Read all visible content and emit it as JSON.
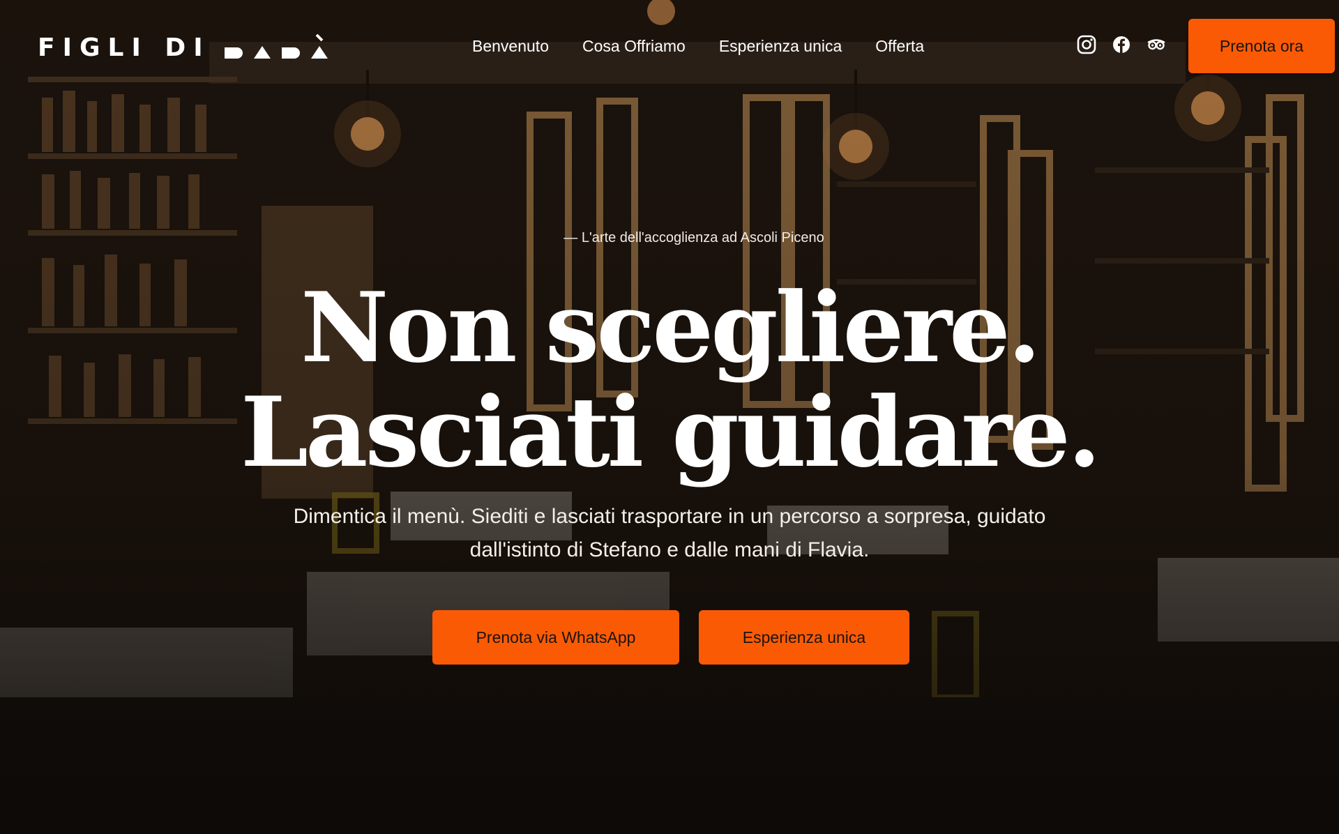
{
  "brand": {
    "logo_text": "FIGLI DI PAPÀ",
    "logo_visible_text": "FIGLI DI"
  },
  "nav": {
    "items": [
      {
        "label": "Benvenuto"
      },
      {
        "label": "Cosa Offriamo"
      },
      {
        "label": "Esperienza unica"
      },
      {
        "label": "Offerta"
      }
    ]
  },
  "socials": [
    {
      "icon": "instagram-icon"
    },
    {
      "icon": "facebook-icon"
    },
    {
      "icon": "tripadvisor-icon"
    }
  ],
  "header": {
    "cta_label": "Prenota ora"
  },
  "hero": {
    "kicker": "— L'arte dell'accoglienza ad Ascoli Piceno",
    "headline_line1": "Non scegliere.",
    "headline_line2": "Lasciati guidare.",
    "subtitle": "Dimentica il menù. Siediti e lasciati trasportare in un percorso a sorpresa, guidato dall'istinto di Stefano e dalle mani di Flavia.",
    "button_primary": "Prenota via WhatsApp",
    "button_secondary": "Esperienza unica"
  },
  "colors": {
    "accent": "#fb5a05",
    "text_light": "#ffffff",
    "background_dark": "#1a1410"
  }
}
